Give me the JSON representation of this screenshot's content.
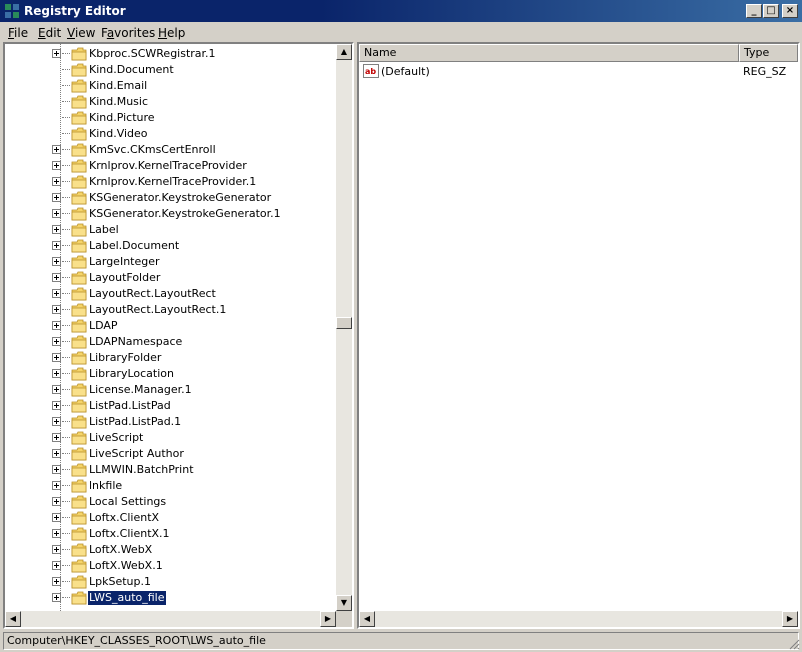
{
  "window": {
    "title": "Registry Editor"
  },
  "titlebar_buttons": {
    "minimize": "_",
    "maximize": "□",
    "close": "×"
  },
  "menu": [
    {
      "label": "File",
      "accel": "F",
      "rest": "ile"
    },
    {
      "label": "Edit",
      "accel": "E",
      "rest": "dit"
    },
    {
      "label": "View",
      "accel": "V",
      "rest": "iew"
    },
    {
      "label": "Favorites",
      "accel": "F",
      "rest": "avorites",
      "prefix": ""
    },
    {
      "label": "Help",
      "accel": "H",
      "rest": "elp"
    }
  ],
  "tree": {
    "items": [
      {
        "label": "Kbproc.SCWRegistrar.1",
        "expandable": true
      },
      {
        "label": "Kind.Document",
        "expandable": false
      },
      {
        "label": "Kind.Email",
        "expandable": false
      },
      {
        "label": "Kind.Music",
        "expandable": false
      },
      {
        "label": "Kind.Picture",
        "expandable": false
      },
      {
        "label": "Kind.Video",
        "expandable": false
      },
      {
        "label": "KmSvc.CKmsCertEnroll",
        "expandable": true
      },
      {
        "label": "Krnlprov.KernelTraceProvider",
        "expandable": true
      },
      {
        "label": "Krnlprov.KernelTraceProvider.1",
        "expandable": true
      },
      {
        "label": "KSGenerator.KeystrokeGenerator",
        "expandable": true
      },
      {
        "label": "KSGenerator.KeystrokeGenerator.1",
        "expandable": true
      },
      {
        "label": "Label",
        "expandable": true
      },
      {
        "label": "Label.Document",
        "expandable": true
      },
      {
        "label": "LargeInteger",
        "expandable": true
      },
      {
        "label": "LayoutFolder",
        "expandable": true
      },
      {
        "label": "LayoutRect.LayoutRect",
        "expandable": true
      },
      {
        "label": "LayoutRect.LayoutRect.1",
        "expandable": true
      },
      {
        "label": "LDAP",
        "expandable": true
      },
      {
        "label": "LDAPNamespace",
        "expandable": true
      },
      {
        "label": "LibraryFolder",
        "expandable": true
      },
      {
        "label": "LibraryLocation",
        "expandable": true
      },
      {
        "label": "License.Manager.1",
        "expandable": true
      },
      {
        "label": "ListPad.ListPad",
        "expandable": true
      },
      {
        "label": "ListPad.ListPad.1",
        "expandable": true
      },
      {
        "label": "LiveScript",
        "expandable": true
      },
      {
        "label": "LiveScript Author",
        "expandable": true
      },
      {
        "label": "LLMWIN.BatchPrint",
        "expandable": true
      },
      {
        "label": "lnkfile",
        "expandable": true
      },
      {
        "label": "Local Settings",
        "expandable": true
      },
      {
        "label": "Loftx.ClientX",
        "expandable": true
      },
      {
        "label": "Loftx.ClientX.1",
        "expandable": true
      },
      {
        "label": "LoftX.WebX",
        "expandable": true
      },
      {
        "label": "LoftX.WebX.1",
        "expandable": true
      },
      {
        "label": "LpkSetup.1",
        "expandable": true
      },
      {
        "label": "LWS_auto_file",
        "expandable": true,
        "selected": true
      }
    ]
  },
  "list": {
    "columns": [
      {
        "label": "Name"
      },
      {
        "label": "Type"
      }
    ],
    "rows": [
      {
        "name": "(Default)",
        "type": "REG_SZ",
        "icon": "string-value-icon"
      }
    ]
  },
  "status": {
    "path": "Computer\\HKEY_CLASSES_ROOT\\LWS_auto_file"
  },
  "colors": {
    "title_active": "#0a246a",
    "selection": "#0a246a",
    "chrome": "#d4d0c8",
    "folder": "#f5d469"
  }
}
